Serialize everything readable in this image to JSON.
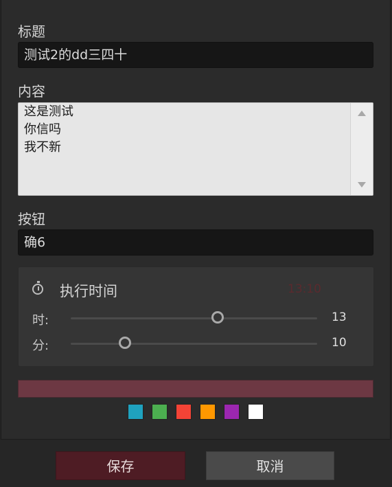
{
  "form": {
    "title_label": "标题",
    "title_value": "测试2的dd三四十",
    "content_label": "内容",
    "content_lines": [
      "这是测试",
      "你信吗",
      "我不新"
    ],
    "button_label": "按钮",
    "button_value": "确6"
  },
  "schedule": {
    "heading": "执行时间",
    "icon": "stopwatch-icon",
    "display": "13:10",
    "hour": {
      "label": "时:",
      "value": "13",
      "min": 0,
      "max": 23
    },
    "minute": {
      "label": "分:",
      "value": "10",
      "min": 0,
      "max": 59
    }
  },
  "color": {
    "selected": "#6d3843",
    "swatches": [
      "#1fa2bf",
      "#4caf50",
      "#f44336",
      "#ff9800",
      "#9c27b0",
      "#ffffff"
    ]
  },
  "actions": {
    "save": "保存",
    "cancel": "取消"
  }
}
